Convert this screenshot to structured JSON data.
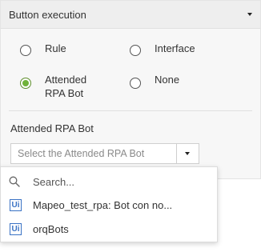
{
  "panel": {
    "title": "Button execution"
  },
  "radios": {
    "rule": "Rule",
    "interface": "Interface",
    "attended_line1": "Attended",
    "attended_line2": "RPA Bot",
    "none": "None",
    "selected": "Attended RPA Bot"
  },
  "attended_section": {
    "label": "Attended RPA Bot",
    "select_placeholder": "Select the Attended RPA Bot"
  },
  "dropdown": {
    "search_placeholder": "Search...",
    "options": [
      {
        "icon_text": "Ui",
        "label": "Mapeo_test_rpa: Bot con no..."
      },
      {
        "icon_text": "Ui",
        "label": "orqBots"
      }
    ]
  },
  "colors": {
    "accent_green": "#70b33a",
    "ui_icon_blue": "#3a72c4"
  },
  "icons": {
    "header_toggle": "chevron-down-icon",
    "select_toggle": "chevron-down-icon",
    "search": "search-icon",
    "option": "ui-bot-icon"
  }
}
